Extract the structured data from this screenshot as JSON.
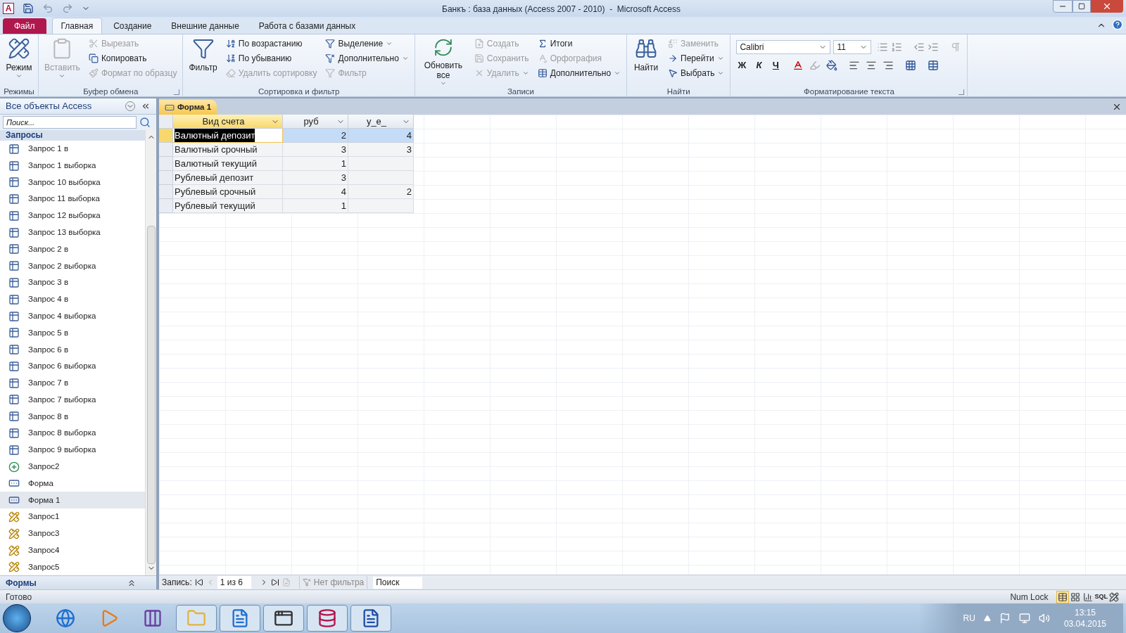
{
  "title_bar": {
    "app_letter": "A",
    "title": "Банкъ : база данных (Access 2007 - 2010)  -  Microsoft Access"
  },
  "ribbon_tabs": [
    {
      "label": "Файл",
      "kind": "file",
      "selected": false
    },
    {
      "label": "Главная",
      "kind": "tab",
      "selected": true
    },
    {
      "label": "Создание",
      "kind": "tab",
      "selected": false
    },
    {
      "label": "Внешние данные",
      "kind": "tab",
      "selected": false
    },
    {
      "label": "Работа с базами данных",
      "kind": "tab",
      "selected": false
    }
  ],
  "ribbon_groups": [
    {
      "kind": "buttons",
      "label": "Режимы",
      "large": [
        {
          "label": "Режим",
          "disabled": false,
          "dropdown": true
        }
      ]
    },
    {
      "kind": "buttons",
      "label": "Буфер обмена",
      "launcher": true,
      "large": [
        {
          "label": "Вставить",
          "disabled": true,
          "dropdown": true
        }
      ],
      "columns": [
        [
          {
            "label": "Вырезать",
            "disabled": true,
            "dropdown": false
          },
          {
            "label": "Копировать",
            "disabled": false,
            "dropdown": false
          },
          {
            "label": "Формат по образцу",
            "disabled": true,
            "dropdown": false
          }
        ]
      ]
    },
    {
      "kind": "buttons",
      "label": "Сортировка и фильтр",
      "large": [
        {
          "label": "Фильтр",
          "disabled": false,
          "dropdown": false
        }
      ],
      "columns": [
        [
          {
            "label": "По возрастанию",
            "disabled": false,
            "dropdown": false
          },
          {
            "label": "По убыванию",
            "disabled": false,
            "dropdown": false
          },
          {
            "label": "Удалить сортировку",
            "disabled": true,
            "dropdown": false
          }
        ],
        [
          {
            "label": "Выделение",
            "disabled": false,
            "dropdown": true
          },
          {
            "label": "Дополнительно",
            "disabled": false,
            "dropdown": true
          },
          {
            "label": "Фильтр",
            "disabled": true,
            "dropdown": false
          }
        ]
      ]
    },
    {
      "kind": "buttons",
      "label": "Записи",
      "large": [
        {
          "label": "Обновить все",
          "disabled": false,
          "dropdown": true
        }
      ],
      "columns": [
        [
          {
            "label": "Создать",
            "disabled": true,
            "dropdown": false
          },
          {
            "label": "Сохранить",
            "disabled": true,
            "dropdown": false
          },
          {
            "label": "Удалить",
            "disabled": true,
            "dropdown": true
          }
        ],
        [
          {
            "label": "Итоги",
            "disabled": false,
            "dropdown": false
          },
          {
            "label": "Орфография",
            "disabled": true,
            "dropdown": false
          },
          {
            "label": "Дополнительно",
            "disabled": false,
            "dropdown": true
          }
        ]
      ]
    },
    {
      "kind": "buttons",
      "label": "Найти",
      "large": [
        {
          "label": "Найти",
          "disabled": false,
          "dropdown": false
        }
      ],
      "columns": [
        [
          {
            "label": "Заменить",
            "disabled": true,
            "dropdown": false
          },
          {
            "label": "Перейти",
            "disabled": false,
            "dropdown": true
          },
          {
            "label": "Выбрать",
            "disabled": false,
            "dropdown": true
          }
        ]
      ]
    },
    {
      "kind": "text_format",
      "label": "Форматирование текста",
      "launcher": true,
      "font": "Calibri",
      "size": "11",
      "style_buttons": [
        "Ж",
        "К",
        "Ч"
      ]
    }
  ],
  "nav": {
    "title": "Все объекты Access",
    "search_placeholder": "Поиск...",
    "group": "Запросы",
    "footer_group": "Формы",
    "items": [
      {
        "label": "Запрос 1 в",
        "kind": "query",
        "selected": false
      },
      {
        "label": "Запрос 1 выборка",
        "kind": "query",
        "selected": false
      },
      {
        "label": "Запрос 10 выборка",
        "kind": "query",
        "selected": false
      },
      {
        "label": "Запрос 11 выборка",
        "kind": "query",
        "selected": false
      },
      {
        "label": "Запрос 12 выборка",
        "kind": "query",
        "selected": false
      },
      {
        "label": "Запрос 13 выборка",
        "kind": "query",
        "selected": false
      },
      {
        "label": "Запрос 2 в",
        "kind": "query",
        "selected": false
      },
      {
        "label": "Запрос 2 выборка",
        "kind": "query",
        "selected": false
      },
      {
        "label": "Запрос 3 в",
        "kind": "query",
        "selected": false
      },
      {
        "label": "Запрос 4 в",
        "kind": "query",
        "selected": false
      },
      {
        "label": "Запрос 4 выборка",
        "kind": "query",
        "selected": false
      },
      {
        "label": "Запрос 5 в",
        "kind": "query",
        "selected": false
      },
      {
        "label": "Запрос 6 в",
        "kind": "query",
        "selected": false
      },
      {
        "label": "Запрос 6 выборка",
        "kind": "query",
        "selected": false
      },
      {
        "label": "Запрос 7 в",
        "kind": "query",
        "selected": false
      },
      {
        "label": "Запрос 7 выборка",
        "kind": "query",
        "selected": false
      },
      {
        "label": "Запрос 8 в",
        "kind": "query",
        "selected": false
      },
      {
        "label": "Запрос 8 выборка",
        "kind": "query",
        "selected": false
      },
      {
        "label": "Запрос 9 выборка",
        "kind": "query",
        "selected": false
      },
      {
        "label": "Запрос2",
        "kind": "append",
        "selected": false
      },
      {
        "label": "Форма",
        "kind": "form",
        "selected": false
      },
      {
        "label": "Форма 1",
        "kind": "form",
        "selected": true
      },
      {
        "label": "Запрос1",
        "kind": "design",
        "selected": false
      },
      {
        "label": "Запрос3",
        "kind": "design",
        "selected": false
      },
      {
        "label": "Запрос4",
        "kind": "design",
        "selected": false
      },
      {
        "label": "Запрос5",
        "kind": "design",
        "selected": false
      }
    ]
  },
  "doc_tabs": [
    {
      "label": "Форма 1",
      "selected": true
    }
  ],
  "table": {
    "columns": [
      {
        "label": "Вид счета",
        "selected": true
      },
      {
        "label": "руб",
        "selected": false
      },
      {
        "label": "у_е_",
        "selected": false
      }
    ],
    "rows": [
      {
        "selected": true,
        "cells": [
          "Валютный депозит",
          "2",
          "4"
        ]
      },
      {
        "selected": false,
        "cells": [
          "Валютный срочный",
          "3",
          "3"
        ]
      },
      {
        "selected": false,
        "cells": [
          "Валютный текущий",
          "1",
          ""
        ]
      },
      {
        "selected": false,
        "cells": [
          "Рублевый депозит",
          "3",
          ""
        ]
      },
      {
        "selected": false,
        "cells": [
          "Рублевый срочный",
          "4",
          "2"
        ]
      },
      {
        "selected": false,
        "cells": [
          "Рублевый текущий",
          "1",
          ""
        ]
      }
    ]
  },
  "record_nav": {
    "label": "Запись:",
    "position": "1 из 6",
    "filter": "Нет фильтра",
    "search_placeholder": "Поиск"
  },
  "status_bar": {
    "text": "Готово",
    "num_lock": "Num Lock",
    "views": [
      {
        "kind": "datasheet",
        "selected": true
      },
      {
        "kind": "pivot_table",
        "selected": false
      },
      {
        "kind": "pivot_chart",
        "selected": false
      },
      {
        "kind": "sql",
        "label": "SQL",
        "selected": false
      },
      {
        "kind": "design",
        "selected": false
      }
    ]
  },
  "taskbar": {
    "apps": [
      {
        "kind": "ie",
        "running": false
      },
      {
        "kind": "media",
        "running": false
      },
      {
        "kind": "vs",
        "running": false
      },
      {
        "kind": "folder",
        "running": true
      },
      {
        "kind": "ie_doc",
        "running": true
      },
      {
        "kind": "window",
        "running": true
      },
      {
        "kind": "access",
        "running": true
      },
      {
        "kind": "word",
        "running": true
      }
    ],
    "language": "RU",
    "time": "13:15",
    "date": "03.04.2015"
  }
}
